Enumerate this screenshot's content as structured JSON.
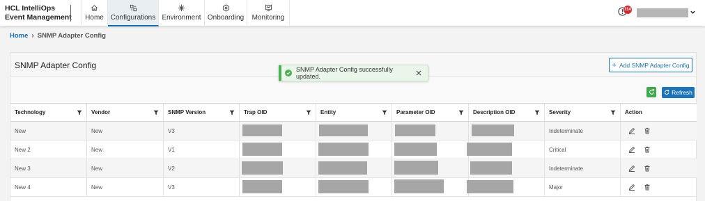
{
  "brand": {
    "line1": "HCL IntelliOps",
    "line2": "Event Management"
  },
  "nav": [
    {
      "label": "Home",
      "icon": "home-icon"
    },
    {
      "label": "Configurations",
      "icon": "configurations-icon",
      "active": true
    },
    {
      "label": "Environment",
      "icon": "environment-icon"
    },
    {
      "label": "Onboarding",
      "icon": "onboarding-icon"
    },
    {
      "label": "Monitoring",
      "icon": "monitoring-icon"
    }
  ],
  "header": {
    "alert_count": "114"
  },
  "breadcrumb": {
    "home": "Home",
    "separator": "›",
    "current": "SNMP Adapter Config"
  },
  "panel": {
    "title": "SNMP Adapter Config",
    "add_button": "Add SNMP Adapter Config",
    "refresh_button": "Refresh"
  },
  "toast": {
    "message": "SNMP Adapter Config successfully updated."
  },
  "table": {
    "columns": [
      "Technology",
      "Vendor",
      "SNMP Version",
      "Trap OID",
      "Entity",
      "Parameter OID",
      "Description OID",
      "Severity",
      "Action"
    ],
    "rows": [
      {
        "technology": "New",
        "vendor": "New",
        "snmp_version": "V3",
        "severity": "Indeterminate"
      },
      {
        "technology": "New 2",
        "vendor": "New",
        "snmp_version": "V1",
        "severity": "Critical"
      },
      {
        "technology": "New 3",
        "vendor": "New",
        "snmp_version": "V2",
        "severity": "Indeterminate"
      },
      {
        "technology": "New 4",
        "vendor": "New",
        "snmp_version": "V3",
        "severity": "Major"
      }
    ]
  },
  "colors": {
    "accent": "#1a73b8",
    "success": "#4caf50",
    "reload": "#3bab4b",
    "badge": "#d9262e",
    "redacted": "#a6a6a6"
  }
}
